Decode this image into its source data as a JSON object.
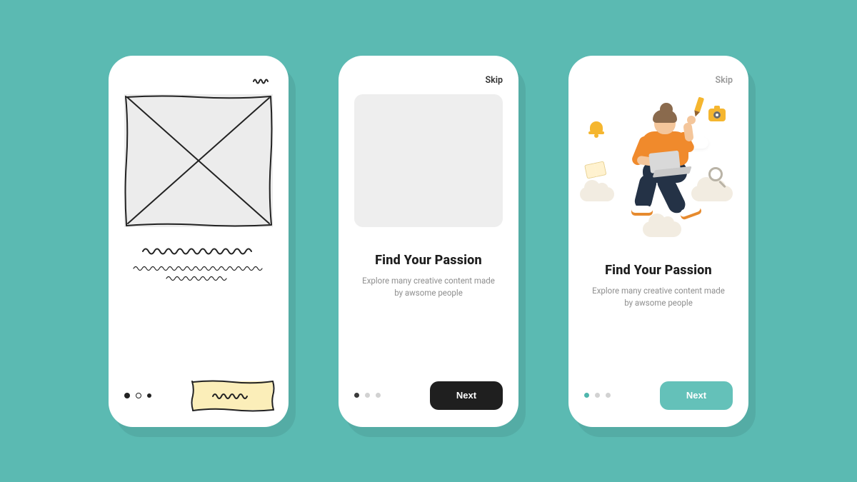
{
  "colors": {
    "background": "#5bbab2",
    "phone_bg": "#ffffff",
    "placeholder": "#eeeeee",
    "text_primary": "#1d1d1d",
    "text_muted": "#8e8e8e",
    "btn_dark": "#1f1f1f",
    "btn_teal": "#64c1b9",
    "dot_inactive": "#d2d2d2",
    "accent_yellow": "#f5b62f",
    "accent_orange": "#f08a2c",
    "accent_navy": "#243246",
    "skin": "#f4c69b",
    "cloud": "#f2ece1"
  },
  "screens": {
    "wireframe": {
      "fidelity": "low-wireframe",
      "page_index": 0,
      "page_count": 3
    },
    "mid": {
      "fidelity": "mid-grayscale",
      "skip_label": "Skip",
      "title": "Find Your Passion",
      "subtitle": "Explore many creative content made by awsome people",
      "next_label": "Next",
      "page_index": 0,
      "page_count": 3
    },
    "hi": {
      "fidelity": "high-color",
      "skip_label": "Skip",
      "title": "Find Your Passion",
      "subtitle": "Explore many creative content made by awsome people",
      "next_label": "Next",
      "page_index": 0,
      "page_count": 3,
      "illustration_icons": [
        "bell-icon",
        "pencil-icon",
        "camera-icon",
        "book-icon",
        "magnifier-icon",
        "cloud-icon"
      ]
    }
  }
}
